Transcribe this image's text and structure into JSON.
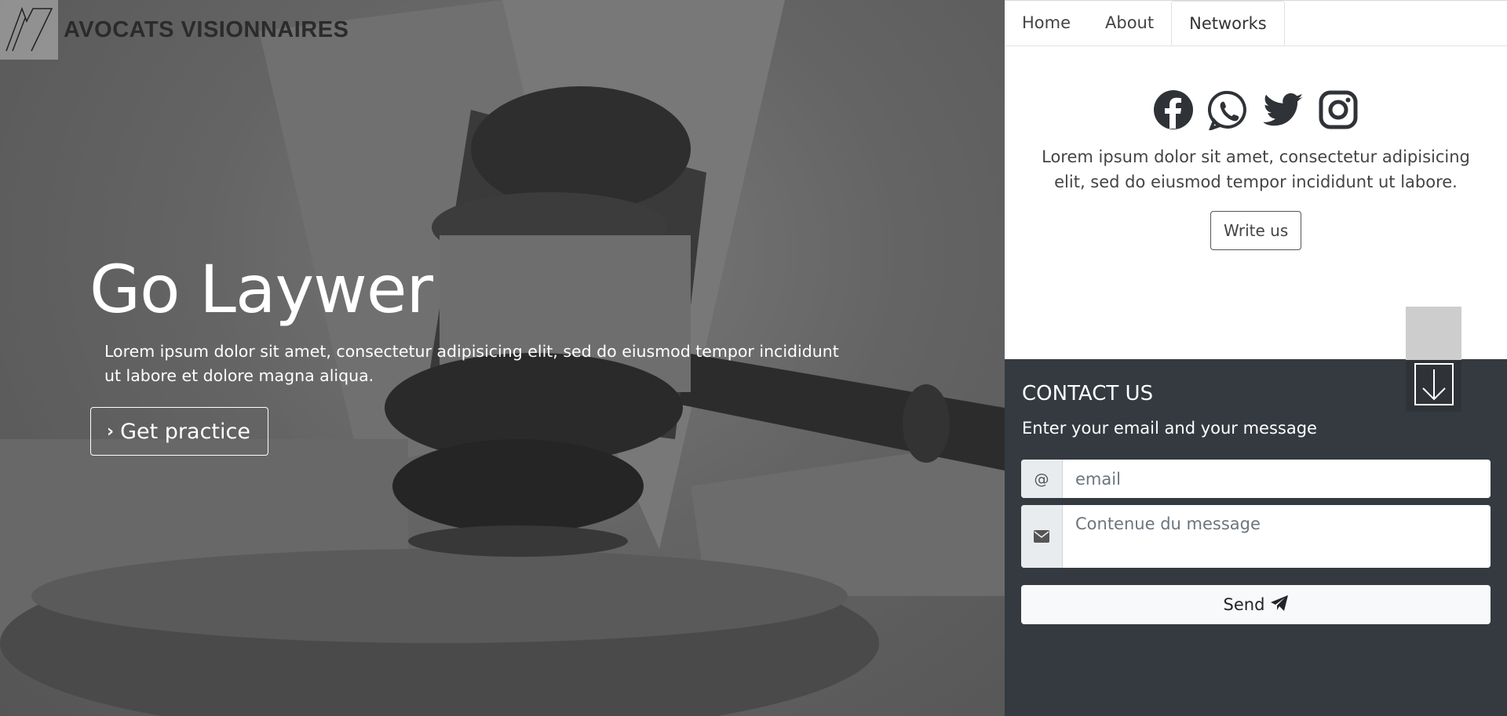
{
  "brand": {
    "name": "AVOCATS VISIONNAIRES",
    "logo_icon": "av-monogram-logo"
  },
  "hero": {
    "title": "Go Laywer",
    "text": "Lorem ipsum dolor sit amet, consectetur adipisicing elit, sed do eiusmod tempor incididunt ut labore et dolore magna aliqua.",
    "button_label": "Get practice",
    "button_icon": "chevron-right-icon"
  },
  "tabs": [
    {
      "label": "Home"
    },
    {
      "label": "About"
    },
    {
      "label": "Networks",
      "active": true
    }
  ],
  "networks": {
    "icons": [
      "facebook-icon",
      "whatsapp-icon",
      "twitter-icon",
      "instagram-icon"
    ],
    "text": "Lorem ipsum dolor sit amet, consectetur adipisicing elit, sed do eiusmod tempor incididunt ut labore.",
    "button_label": "Write us"
  },
  "scroll_icon": "arrow-down-icon",
  "contact": {
    "title": "CONTACT US",
    "subtitle": "Enter your email and your message",
    "email_addon": "@",
    "email_placeholder": "email",
    "message_icon": "envelope-icon",
    "message_placeholder": "Contenue du message",
    "send_label": "Send",
    "send_icon": "paper-plane-icon"
  },
  "colors": {
    "contact_bg": "#343a40",
    "hero_overlay": "#5e5e5e",
    "icon_color": "#2f3338"
  }
}
